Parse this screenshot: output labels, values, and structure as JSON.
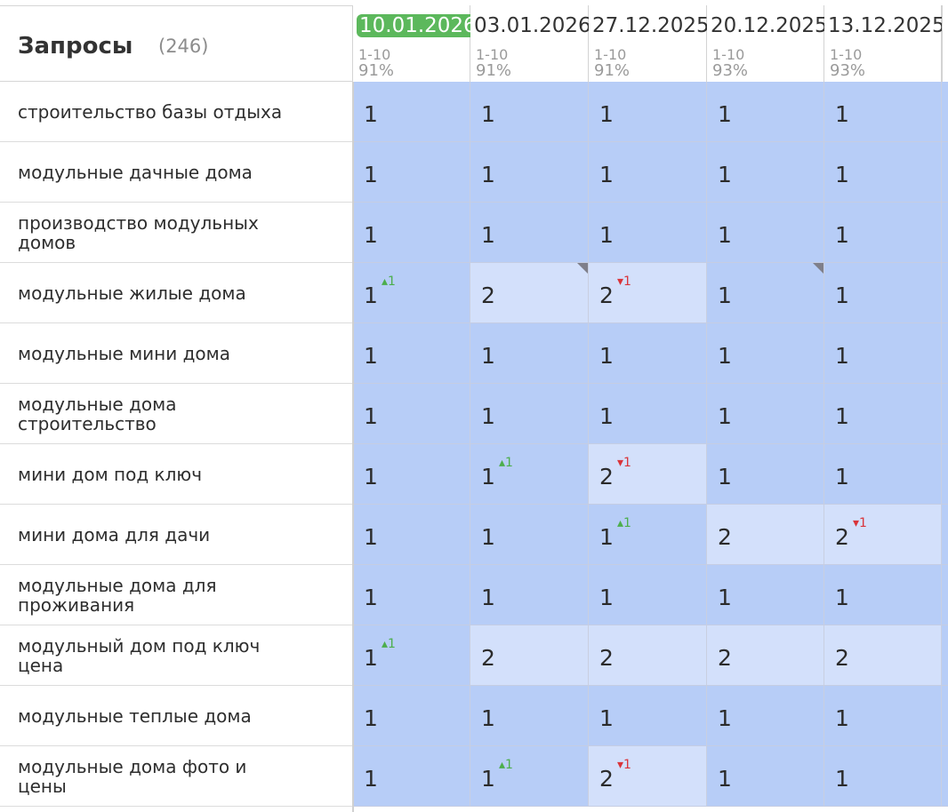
{
  "header": {
    "title": "Запросы",
    "count": "(246)"
  },
  "dates": [
    {
      "label": "10.01.2026",
      "range": "1-10",
      "pct": "91%",
      "current": true
    },
    {
      "label": "03.01.2026",
      "range": "1-10",
      "pct": "91%",
      "current": false
    },
    {
      "label": "27.12.2025",
      "range": "1-10",
      "pct": "91%",
      "current": false
    },
    {
      "label": "20.12.2025",
      "range": "1-10",
      "pct": "93%",
      "current": false
    },
    {
      "label": "13.12.2025",
      "range": "1-10",
      "pct": "93%",
      "current": false
    }
  ],
  "rows": [
    {
      "query": "строительство базы отдыха",
      "cells": [
        {
          "v": "1"
        },
        {
          "v": "1"
        },
        {
          "v": "1"
        },
        {
          "v": "1"
        },
        {
          "v": "1"
        }
      ]
    },
    {
      "query": "модульные дачные дома",
      "cells": [
        {
          "v": "1"
        },
        {
          "v": "1"
        },
        {
          "v": "1"
        },
        {
          "v": "1"
        },
        {
          "v": "1"
        }
      ]
    },
    {
      "query": "производство модульных домов",
      "cells": [
        {
          "v": "1"
        },
        {
          "v": "1"
        },
        {
          "v": "1"
        },
        {
          "v": "1"
        },
        {
          "v": "1"
        }
      ]
    },
    {
      "query": "модульные жилые дома",
      "cells": [
        {
          "v": "1",
          "d": "▴1",
          "dir": "up"
        },
        {
          "v": "2",
          "corner": true
        },
        {
          "v": "2",
          "d": "▾1",
          "dir": "down"
        },
        {
          "v": "1",
          "corner": true
        },
        {
          "v": "1"
        }
      ]
    },
    {
      "query": "модульные мини дома",
      "cells": [
        {
          "v": "1"
        },
        {
          "v": "1"
        },
        {
          "v": "1"
        },
        {
          "v": "1"
        },
        {
          "v": "1"
        }
      ]
    },
    {
      "query": "модульные дома строительство",
      "cells": [
        {
          "v": "1"
        },
        {
          "v": "1"
        },
        {
          "v": "1"
        },
        {
          "v": "1"
        },
        {
          "v": "1"
        }
      ]
    },
    {
      "query": "мини дом под ключ",
      "cells": [
        {
          "v": "1"
        },
        {
          "v": "1",
          "d": "▴1",
          "dir": "up"
        },
        {
          "v": "2",
          "d": "▾1",
          "dir": "down"
        },
        {
          "v": "1"
        },
        {
          "v": "1"
        }
      ]
    },
    {
      "query": "мини дома для дачи",
      "cells": [
        {
          "v": "1"
        },
        {
          "v": "1"
        },
        {
          "v": "1",
          "d": "▴1",
          "dir": "up"
        },
        {
          "v": "2"
        },
        {
          "v": "2",
          "d": "▾1",
          "dir": "down"
        }
      ]
    },
    {
      "query": "модульные дома для проживания",
      "cells": [
        {
          "v": "1"
        },
        {
          "v": "1"
        },
        {
          "v": "1"
        },
        {
          "v": "1"
        },
        {
          "v": "1"
        }
      ]
    },
    {
      "query": "модульный дом под ключ цена",
      "cells": [
        {
          "v": "1",
          "d": "▴1",
          "dir": "up"
        },
        {
          "v": "2"
        },
        {
          "v": "2"
        },
        {
          "v": "2"
        },
        {
          "v": "2"
        }
      ]
    },
    {
      "query": "модульные теплые дома",
      "cells": [
        {
          "v": "1"
        },
        {
          "v": "1"
        },
        {
          "v": "1"
        },
        {
          "v": "1"
        },
        {
          "v": "1"
        }
      ]
    },
    {
      "query": "модульные дома фото и цены",
      "cells": [
        {
          "v": "1"
        },
        {
          "v": "1",
          "d": "▴1",
          "dir": "up"
        },
        {
          "v": "2",
          "d": "▾1",
          "dir": "down"
        },
        {
          "v": "1"
        },
        {
          "v": "1"
        }
      ]
    }
  ],
  "colors": {
    "pos1": "#b7cdf7",
    "pos2": "#d3e0fb",
    "current_date": "#5cb85c"
  }
}
